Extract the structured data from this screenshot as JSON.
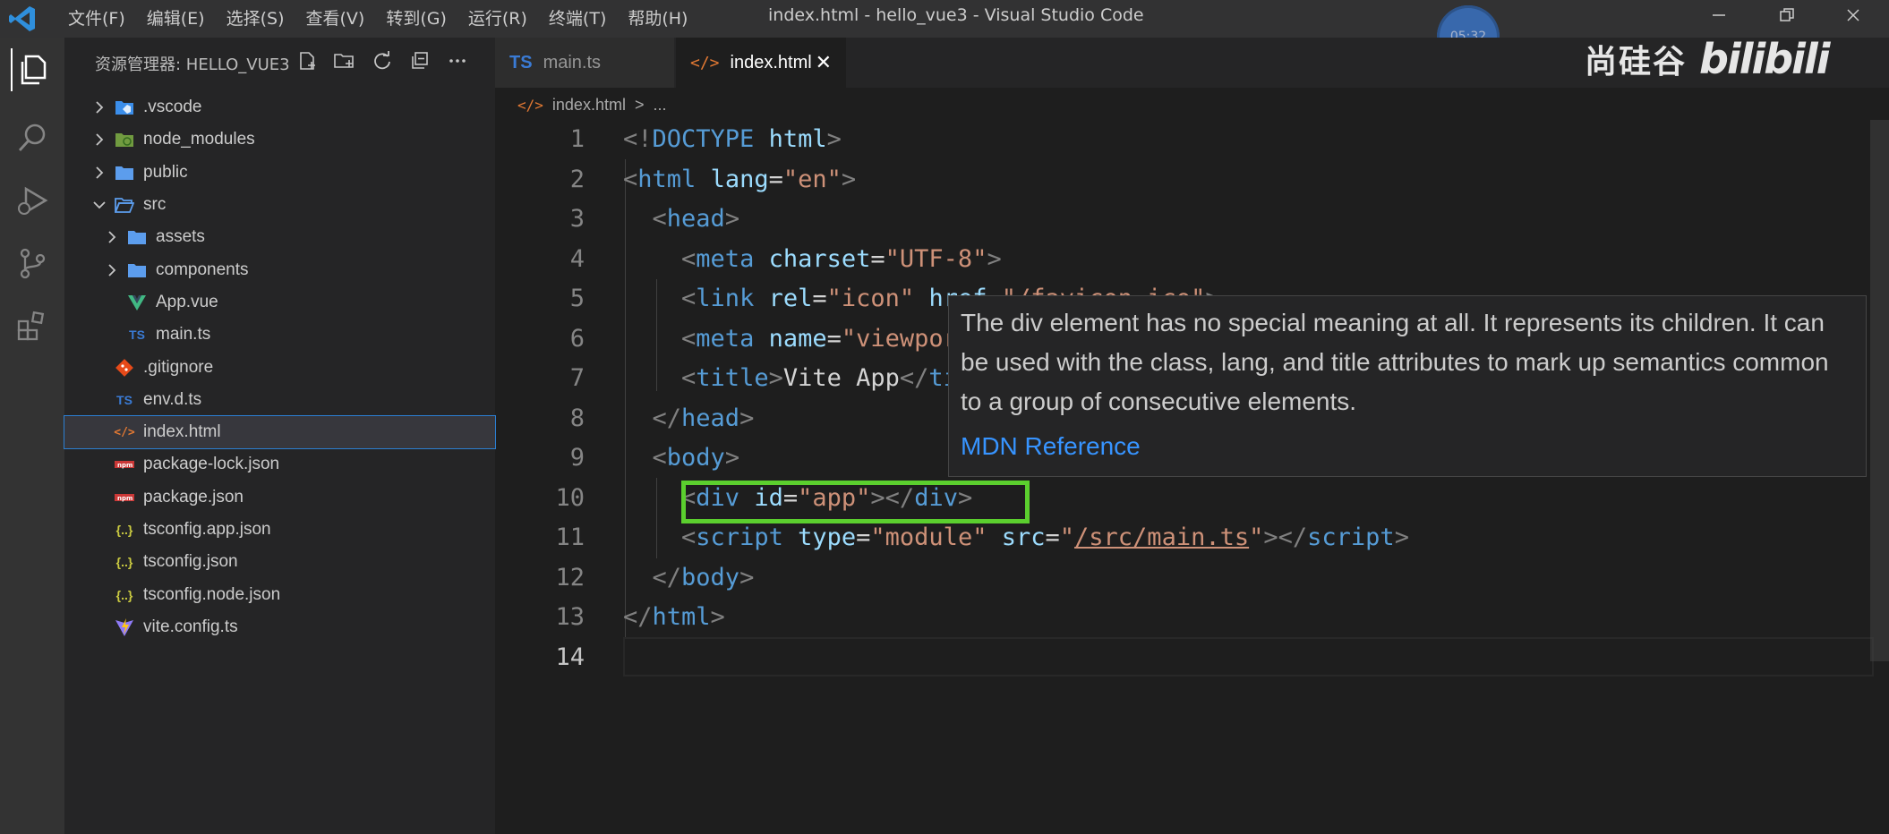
{
  "menu": [
    "文件(F)",
    "编辑(E)",
    "选择(S)",
    "查看(V)",
    "转到(G)",
    "运行(R)",
    "终端(T)",
    "帮助(H)"
  ],
  "window_title": "index.html - hello_vue3 - Visual Studio Code",
  "clock_badge": "05:32",
  "watermark": {
    "brand_cn": "尚硅谷",
    "logo": "bilibili"
  },
  "sidebar": {
    "title": "资源管理器: HELLO_VUE3",
    "tree": [
      {
        "label": ".vscode",
        "type": "folder",
        "icon": "vscode-folder-icon",
        "indent": 0
      },
      {
        "label": "node_modules",
        "type": "folder",
        "icon": "node-folder-icon",
        "indent": 0
      },
      {
        "label": "public",
        "type": "folder",
        "icon": "folder-icon",
        "indent": 0
      },
      {
        "label": "src",
        "type": "folder-open",
        "icon": "folder-open-icon",
        "indent": 0
      },
      {
        "label": "assets",
        "type": "folder",
        "icon": "folder-icon",
        "indent": 1
      },
      {
        "label": "components",
        "type": "folder",
        "icon": "folder-icon",
        "indent": 1
      },
      {
        "label": "App.vue",
        "type": "file",
        "icon": "vue-icon",
        "indent": 1
      },
      {
        "label": "main.ts",
        "type": "file",
        "icon": "ts-icon",
        "indent": 1
      },
      {
        "label": ".gitignore",
        "type": "file",
        "icon": "git-icon",
        "indent": 0
      },
      {
        "label": "env.d.ts",
        "type": "file",
        "icon": "ts-icon",
        "indent": 0
      },
      {
        "label": "index.html",
        "type": "file",
        "icon": "html-icon",
        "indent": 0,
        "selected": true
      },
      {
        "label": "package-lock.json",
        "type": "file",
        "icon": "npm-icon",
        "indent": 0
      },
      {
        "label": "package.json",
        "type": "file",
        "icon": "npm-icon",
        "indent": 0
      },
      {
        "label": "tsconfig.app.json",
        "type": "file",
        "icon": "json-icon",
        "indent": 0
      },
      {
        "label": "tsconfig.json",
        "type": "file",
        "icon": "json-icon",
        "indent": 0
      },
      {
        "label": "tsconfig.node.json",
        "type": "file",
        "icon": "json-icon",
        "indent": 0
      },
      {
        "label": "vite.config.ts",
        "type": "file",
        "icon": "vite-icon",
        "indent": 0
      }
    ]
  },
  "tabs": {
    "inactive": {
      "badge": "TS",
      "label": "main.ts"
    },
    "active": {
      "badge": "</>",
      "label": "index.html",
      "close": "✕"
    }
  },
  "breadcrumb": {
    "file": "index.html",
    "separator": ">",
    "more": "..."
  },
  "editor": {
    "line_numbers": [
      "1",
      "2",
      "3",
      "4",
      "5",
      "6",
      "7",
      "8",
      "9",
      "10",
      "11",
      "12",
      "13",
      "14"
    ],
    "current_line": "14"
  },
  "hover": {
    "description": "The div element has no special meaning at all. It represents its children. It can be used with the class, lang, and title attributes to mark up semantics common to a group of consecutive elements.",
    "link": "MDN Reference"
  },
  "colors": {
    "tag": "#569cd6",
    "attr": "#9cdcfe",
    "string": "#ce9178",
    "punct": "#808080",
    "highlight": "#5bcf2e",
    "link": "#3794ff",
    "ts_badge": "#3a7bd5"
  }
}
